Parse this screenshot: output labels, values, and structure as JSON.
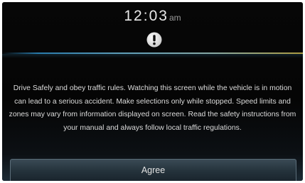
{
  "header": {
    "time": "12:03",
    "ampm": "am"
  },
  "icons": {
    "alert": "exclamation-icon"
  },
  "message": {
    "text": "Drive Safely and obey traffic rules. Watching this screen while the vehicle is in motion can lead to a serious accident. Make selections only while stopped. Speed limits and zones may vary from information displayed on screen. Read the safety instructions from your manual and always follow local traffic regulations."
  },
  "actions": {
    "agree_label": "Agree"
  },
  "colors": {
    "background": "#050505",
    "text": "#dcdcdc",
    "divider_start": "#2f8fc8",
    "divider_end": "#c8b44a",
    "button": "#2b3a44"
  }
}
